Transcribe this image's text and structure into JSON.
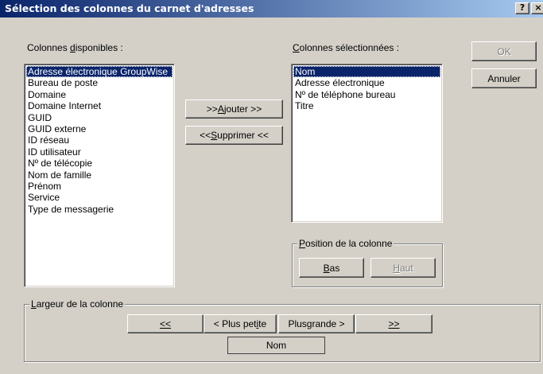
{
  "dialog": {
    "title": "Sélection des colonnes du carnet d'adresses",
    "help_button": "?",
    "close_button": "×"
  },
  "available": {
    "label_pre": "Colonnes ",
    "label_access": "d",
    "label_post": "isponibles :",
    "items": [
      "Adresse électronique GroupWise",
      "Bureau de poste",
      "Domaine",
      "Domaine Internet",
      "GUID",
      "GUID externe",
      "ID réseau",
      "ID utilisateur",
      "Nº de télécopie",
      "Nom de famille",
      "Prénom",
      "Service",
      "Type de messagerie"
    ],
    "selected_index": 0
  },
  "selected": {
    "label_access": "C",
    "label_post": "olonnes sélectionnées :",
    "items": [
      "Nom",
      "Adresse électronique",
      "Nº de téléphone bureau",
      "Titre"
    ],
    "selected_index": 0
  },
  "buttons": {
    "add_pre": ">> ",
    "add_access": "A",
    "add_post": "jouter >>",
    "remove_pre": "<< ",
    "remove_access": "S",
    "remove_post": "upprimer <<",
    "ok": "OK",
    "cancel": "Annuler"
  },
  "position": {
    "legend_access": "P",
    "legend_post": "osition de la colonne",
    "down_access": "B",
    "down_post": "as",
    "up_access": "H",
    "up_post": "aut"
  },
  "width": {
    "legend_access": "L",
    "legend_post": "argeur de la colonne",
    "min_label": "<<",
    "smaller_pre": "< Plus pet",
    "smaller_access": "i",
    "smaller_post": "te",
    "larger_pre": "Plus ",
    "larger_access": "g",
    "larger_post": "rande >",
    "max_label": ">>",
    "current_column": "Nom"
  }
}
